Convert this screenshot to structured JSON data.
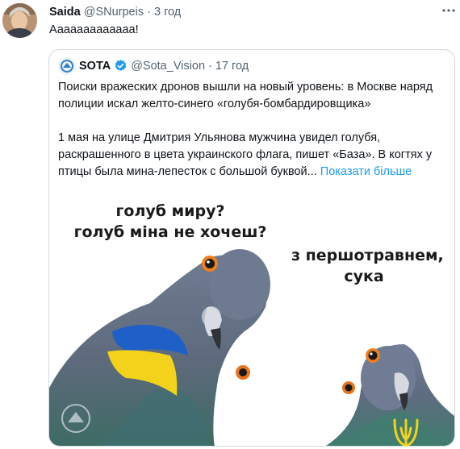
{
  "tweet": {
    "author_name": "Saida",
    "handle": "@SNurpeis",
    "separator": "·",
    "time": "3 год",
    "text": "Ааааааааааааа!"
  },
  "quote": {
    "author_name": "SOTA",
    "handle": "@Sota_Vision",
    "separator": "·",
    "time": "17 год",
    "paragraph1": "Поиски вражеских дронов вышли на новый уровень: в Москве наряд полиции искал желто-синего «голубя-бомбардировщика»",
    "paragraph2": "1 мая на улице Дмитрия Ульянова мужчина увидел голубя, раскрашенного в цвета украинского флага, пишет «База». В когтях у птицы была мина-лепесток с большой буквой...",
    "show_more": "Показати більше",
    "meme": {
      "caption_left_line1": "голуб миру?",
      "caption_left_line2": "голуб міна не хочеш?",
      "caption_right_line1": "з першотравнем,",
      "caption_right_line2": "сука"
    }
  },
  "colors": {
    "accent": "#1d9bf0",
    "muted": "#536471",
    "border": "#cfd9de",
    "flag_blue": "#1f5fc8",
    "flag_yellow": "#f2d21b"
  },
  "icons": [
    "more-icon",
    "verified-badge-icon",
    "sota-logo-icon"
  ]
}
